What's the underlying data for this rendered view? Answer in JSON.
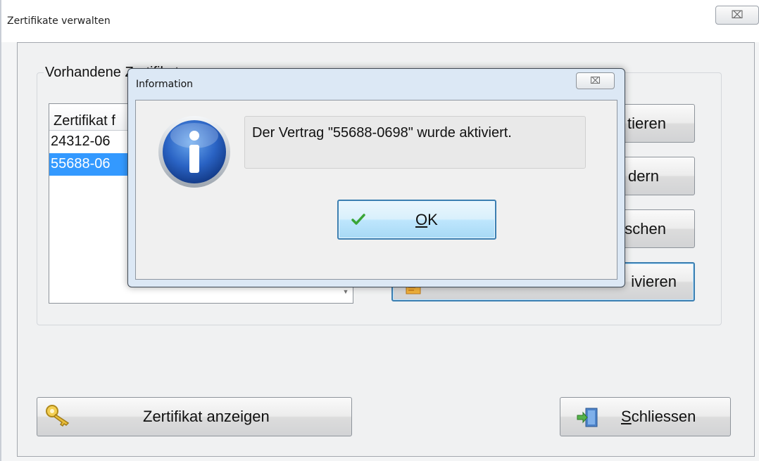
{
  "window": {
    "title": "Zertifikate verwalten",
    "close_glyph": "⌧"
  },
  "certificates": {
    "group_label": "Vorhandene Zertifikate",
    "column_header": "Zertifikat f",
    "rows": [
      {
        "label": "24312-06",
        "selected": false
      },
      {
        "label": "55688-06",
        "selected": true
      }
    ]
  },
  "side_buttons": [
    {
      "label": "tieren"
    },
    {
      "label": "dern"
    },
    {
      "label": "schen"
    },
    {
      "label": "ivieren",
      "icon": "certificate-icon"
    }
  ],
  "bottom_buttons": {
    "show_certificate": {
      "label": "Zertifikat anzeigen",
      "icon": "key-icon"
    },
    "close": {
      "label_underlined": "S",
      "label_rest": "chliessen",
      "icon": "exit-door-icon"
    }
  },
  "dialog": {
    "title": "Information",
    "close_glyph": "⌧",
    "icon": "info-icon",
    "message": "Der Vertrag \"55688-0698\" wurde aktiviert.",
    "ok_button": {
      "label_underlined": "O",
      "label_rest": "K",
      "icon": "check-icon"
    }
  },
  "colors": {
    "selection": "#3399ff",
    "focus_border": "#3c7fb1",
    "dialog_frame": "#dce8f5"
  }
}
